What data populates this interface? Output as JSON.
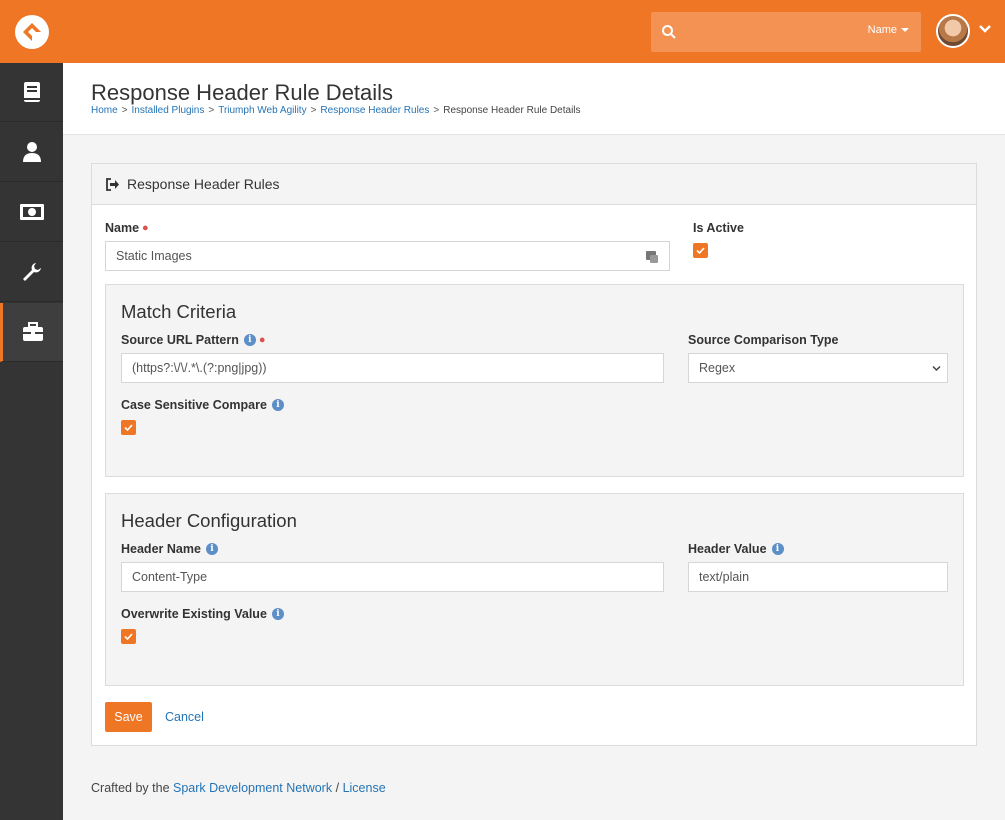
{
  "topbar": {
    "search": {
      "value": "",
      "filter_label": "Name"
    }
  },
  "sidebar": {
    "items": [
      {
        "icon": "book-icon"
      },
      {
        "icon": "person-icon"
      },
      {
        "icon": "money-icon"
      },
      {
        "icon": "wrench-icon"
      },
      {
        "icon": "briefcase-icon",
        "active": true
      }
    ]
  },
  "page": {
    "title": "Response Header Rule Details",
    "breadcrumb": [
      "Home",
      "Installed Plugins",
      "Triumph Web Agility",
      "Response Header Rules",
      "Response Header Rule Details"
    ]
  },
  "panel": {
    "heading": "Response Header Rules",
    "name_label": "Name",
    "name_value": "Static Images",
    "is_active_label": "Is Active",
    "is_active": true,
    "match": {
      "title": "Match Criteria",
      "source_url_label": "Source URL Pattern",
      "source_url_value": "(https?:\\/\\/.*\\.(?:png|jpg))",
      "comparison_label": "Source Comparison Type",
      "comparison_value": "Regex",
      "case_label": "Case Sensitive Compare",
      "case_checked": true
    },
    "header": {
      "title": "Header Configuration",
      "name_label": "Header Name",
      "name_value": "Content-Type",
      "value_label": "Header Value",
      "value_value": "text/plain",
      "overwrite_label": "Overwrite Existing Value",
      "overwrite_checked": true
    },
    "save_label": "Save",
    "cancel_label": "Cancel"
  },
  "footer": {
    "prefix": "Crafted by the",
    "link1": "Spark Development Network",
    "sep": "/",
    "link2": "License"
  },
  "colors": {
    "accent": "#ee7625",
    "sidebar": "#343434",
    "link": "#2574b5"
  }
}
